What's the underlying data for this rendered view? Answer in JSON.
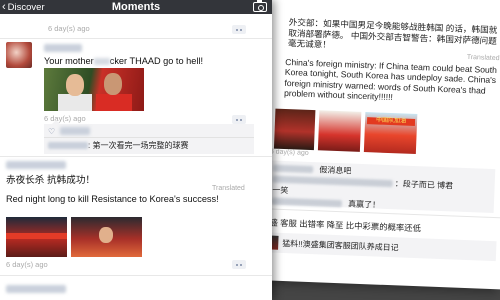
{
  "nav": {
    "back_label": "Discover",
    "title": "Moments"
  },
  "icons": {
    "back": "chevron-left-icon",
    "camera": "camera-icon",
    "like": "heart-icon",
    "more": "more-dots-icon"
  },
  "colors": {
    "navbar_bg": "#33353a",
    "link_blue": "#7b8aa5",
    "comment_bg": "#f3f3f5"
  },
  "feed": {
    "post0": {
      "time": "6 day(s) ago"
    },
    "post1": {
      "text_before": "Your  mother",
      "text_after": "cker THAAD go to hell!",
      "time": "6 day(s) ago",
      "comment": ": 第一次看完一场完整的球赛"
    },
    "post2": {
      "text_zh": "赤夜长杀 抗韩成功！",
      "translated_label": "Translated",
      "text_en": "Red night long to kill Resistance to Korea's success!",
      "time": "6 day(s) ago"
    }
  },
  "background_screen": {
    "post1": {
      "text_zh": "外交部：如果中国男足今晚能够战胜韩国 的话，韩国就取消部署萨德。 中国外交部吉智警告：韩国对萨德问题毫无诚意！",
      "translated_label": "Translated",
      "text_en": "China's foreign ministry: If China team could beat South Korea tonight, South Korea has undeploy sade. China's foreign ministry warned: words of South Korea's thad problem without sincerity!!!!!!",
      "photo_banner": "中国队加油",
      "time": "6 day(s) ago",
      "comment1": "假消息吧",
      "comment2": "：段子而已 博君",
      "comment3": "一笑",
      "comment4": "真赢了！"
    },
    "post2": {
      "text_zh": "澳盛 客服 出错率 降至 比中彩票的概率还低",
      "link_title": "猛料!!澳盛集团客服团队养成日记"
    }
  }
}
